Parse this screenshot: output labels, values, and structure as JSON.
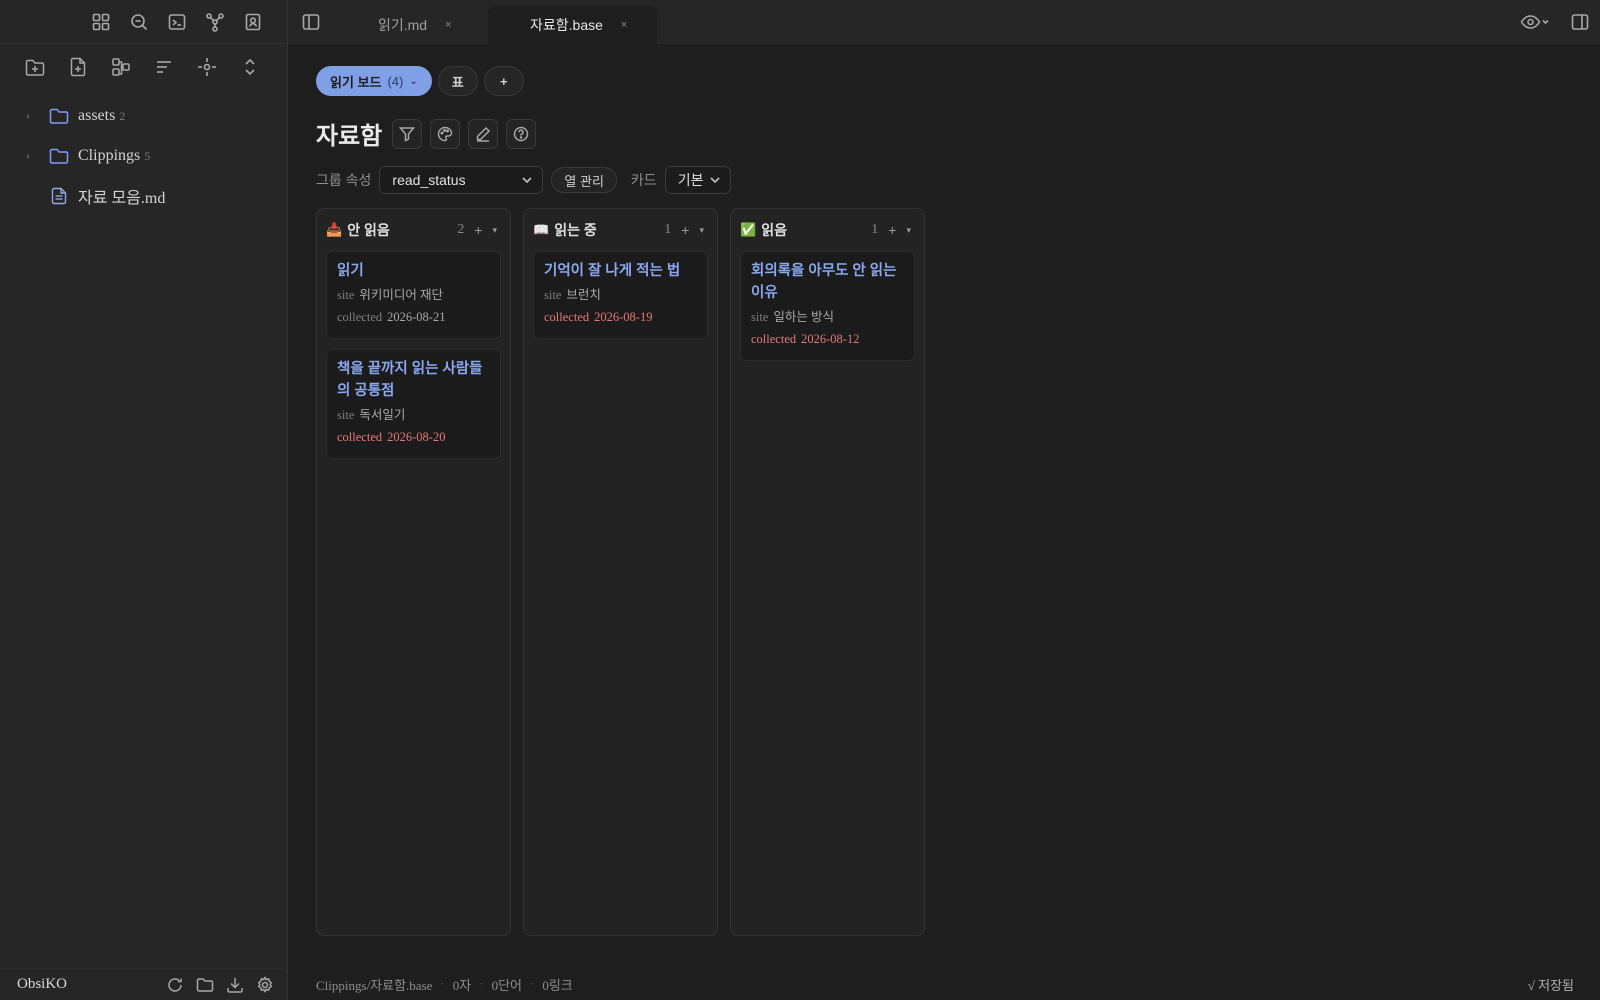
{
  "ribbon": {
    "icons": [
      "dashboard-icon",
      "search-icon",
      "terminal-icon",
      "graph-icon",
      "contacts-icon"
    ]
  },
  "nav_actions": [
    "new-folder-icon",
    "new-note-icon",
    "canvas-icon",
    "sort-icon",
    "focus-icon",
    "collapse-icon"
  ],
  "tree": [
    {
      "type": "folder",
      "label": "assets",
      "count": "2"
    },
    {
      "type": "folder",
      "label": "Clippings",
      "count": "5"
    },
    {
      "type": "file",
      "label": "자료 모음.md"
    }
  ],
  "vault_name": "ObsiKO",
  "tabs": [
    {
      "label": "읽기.md",
      "close": "×",
      "active": false
    },
    {
      "label": "자료함.base",
      "close": "×",
      "active": true
    }
  ],
  "views": {
    "active_label": "읽기 보드",
    "active_count": "(4)",
    "table_label": "표",
    "add_label": "+"
  },
  "base_title": "자료함",
  "controls": {
    "group_label": "그룹 속성",
    "group_value": "read_status",
    "columns_button": "열 관리",
    "card_label": "카드",
    "card_value": "기본"
  },
  "columns": [
    {
      "emoji": "📥",
      "name": "안 읽음",
      "count": "2",
      "plus": "+",
      "menu": "▾",
      "cards": [
        {
          "title": "읽기",
          "site_key": "site",
          "site": "위키미디어 재단",
          "collected_key": "collected",
          "collected": "2026-08-21",
          "highlight": false
        },
        {
          "title": "책을 끝까지 읽는 사람들의 공통점",
          "site_key": "site",
          "site": "독서일기",
          "collected_key": "collected",
          "collected": "2026-08-20",
          "highlight": true
        }
      ]
    },
    {
      "emoji": "📖",
      "name": "읽는 중",
      "count": "1",
      "plus": "+",
      "menu": "▾",
      "cards": [
        {
          "title": "기억이 잘 나게 적는 법",
          "site_key": "site",
          "site": "브런치",
          "collected_key": "collected",
          "collected": "2026-08-19",
          "highlight": true
        }
      ]
    },
    {
      "emoji": "✅",
      "name": "읽음",
      "count": "1",
      "plus": "+",
      "menu": "▾",
      "cards": [
        {
          "title": "회의록을 아무도 안 읽는 이유",
          "site_key": "site",
          "site": "일하는 방식",
          "collected_key": "collected",
          "collected": "2026-08-12",
          "highlight": true
        }
      ]
    }
  ],
  "status": {
    "path": "Clippings/자료함.base",
    "chars": "0자",
    "words": "0단어",
    "links": "0링크",
    "saved": "√ 저장됨"
  },
  "colors": {
    "accent": "#7f9fe6",
    "card_title": "#8aa8f0",
    "highlight": "#e8787a"
  }
}
